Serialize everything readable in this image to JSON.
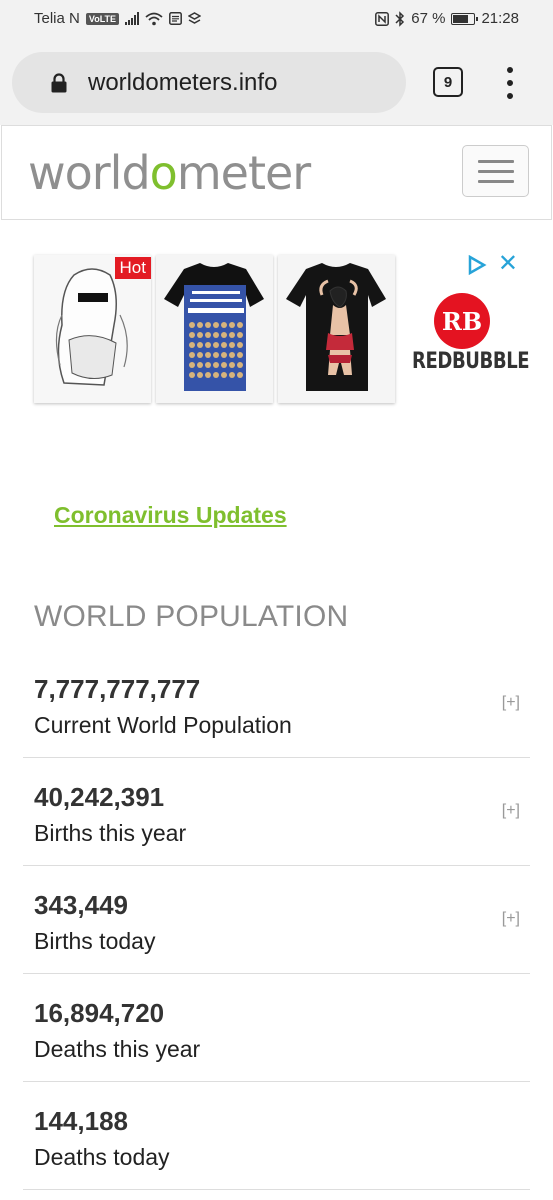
{
  "status_bar": {
    "carrier": "Telia N",
    "volte": "VoLTE",
    "battery_text": "67 %",
    "battery_level": 0.67,
    "time": "21:28"
  },
  "browser": {
    "url": "worldometers.info",
    "tab_count": "9"
  },
  "site": {
    "logo_left": "world",
    "logo_accent": "o",
    "logo_right": "meter",
    "accent_color": "#7fbf2e"
  },
  "ad": {
    "hot_label": "Hot",
    "brand_logo": "RB",
    "brand_name": "REDBUBBLE"
  },
  "links": {
    "coronavirus": "Coronavirus Updates"
  },
  "world_population": {
    "title": "WORLD POPULATION",
    "expand_label": "[+]",
    "rows": [
      {
        "value": "7,777,777,777",
        "label": "Current World Population"
      },
      {
        "value": "40,242,391",
        "label": "Births this year"
      },
      {
        "value": "343,449",
        "label": "Births today"
      },
      {
        "value": "16,894,720",
        "label": "Deaths this year"
      },
      {
        "value": "144,188",
        "label": "Deaths today"
      }
    ]
  }
}
